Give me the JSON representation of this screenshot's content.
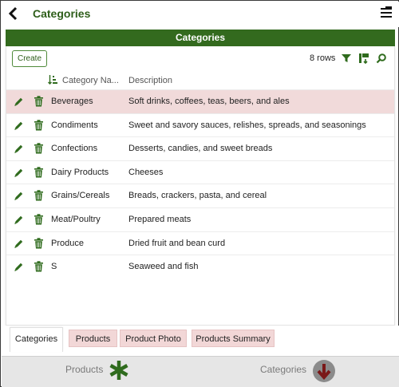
{
  "header": {
    "title": "Categories",
    "back_icon": "chevron-left-icon",
    "menu_icon": "hamburger-menu-icon"
  },
  "band": {
    "title": "Categories"
  },
  "toolbar": {
    "create_label": "Create",
    "row_count": "8 rows",
    "accent": "#336a1e"
  },
  "table": {
    "columns": {
      "name": "Category Na...",
      "desc": "Description"
    },
    "rows": [
      {
        "name": "Beverages",
        "desc": "Soft drinks, coffees, teas, beers, and ales",
        "selected": true
      },
      {
        "name": "Condiments",
        "desc": "Sweet and savory sauces, relishes, spreads, and seasonings"
      },
      {
        "name": "Confections",
        "desc": "Desserts, candies, and sweet breads"
      },
      {
        "name": "Dairy Products",
        "desc": "Cheeses"
      },
      {
        "name": "Grains/Cereals",
        "desc": "Breads, crackers, pasta, and cereal"
      },
      {
        "name": "Meat/Poultry",
        "desc": "Prepared meats"
      },
      {
        "name": "Produce",
        "desc": "Dried fruit and bean curd"
      },
      {
        "name": "S",
        "desc": "Seaweed and fish"
      }
    ]
  },
  "tabs": [
    {
      "label": "Categories",
      "active": true
    },
    {
      "label": "Products"
    },
    {
      "label": "Product Photo"
    },
    {
      "label": "Products Summary"
    }
  ],
  "bottom": {
    "left_label": "Products",
    "right_label": "Categories"
  }
}
